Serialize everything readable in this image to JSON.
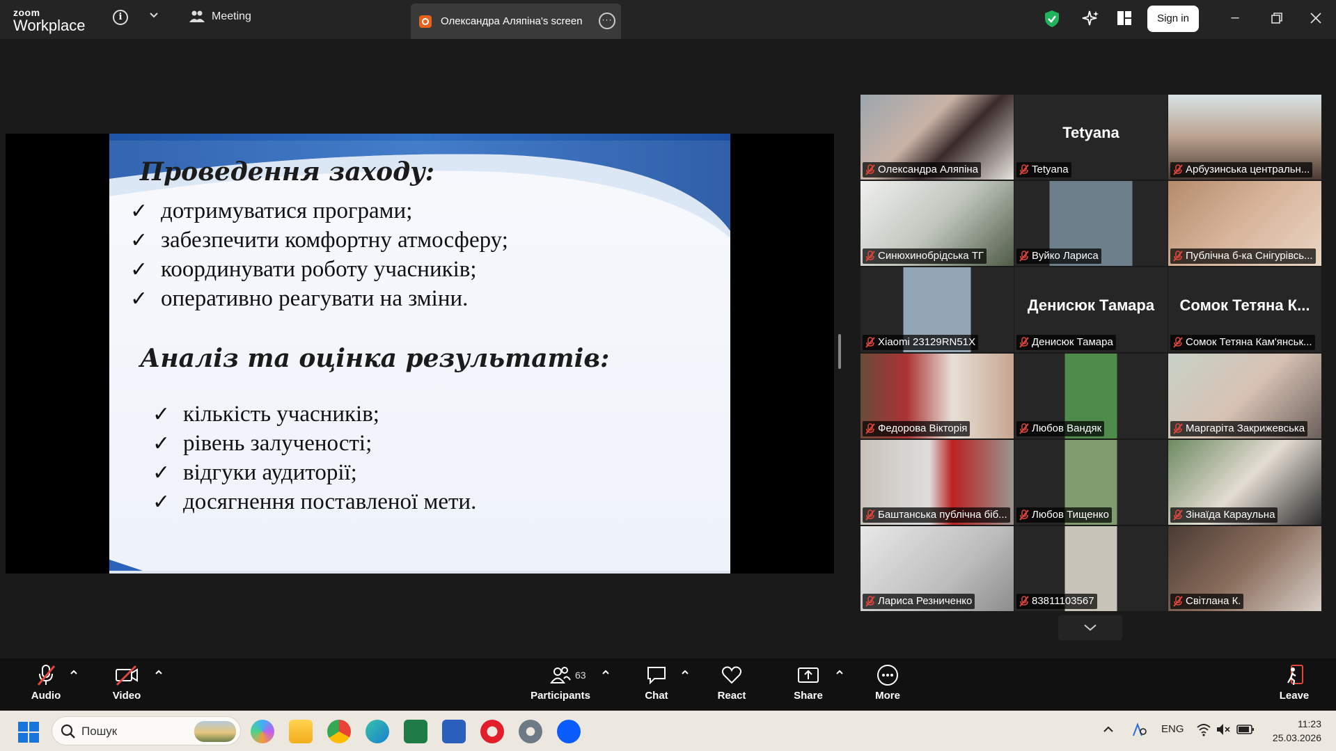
{
  "app": {
    "brand_top": "zoom",
    "brand_bottom": "Workplace",
    "meeting_tab": "Meeting",
    "screen_tab": "Олександра Аляпіна's screen",
    "sign_in": "Sign in",
    "colors": {
      "titlebar": "#242424",
      "accent_green": "#33d36b",
      "share_icon": "#e8611a",
      "muted_red": "#e0463c"
    }
  },
  "slide": {
    "heading1": "Проведення заходу:",
    "list1": [
      "дотримуватися програми;",
      "забезпечити комфортну атмосферу;",
      "координувати роботу учасників;",
      "оперативно реагувати на зміни."
    ],
    "heading2": "Аналіз та оцінка результатів:",
    "list2": [
      "кількість учасників;",
      "рівень залученості;",
      "відгуки аудиторії;",
      "досягнення поставленої мети."
    ],
    "check": "✓"
  },
  "gallery": {
    "tiles": [
      {
        "name": "Олександра Аляпіна",
        "big": "",
        "active": true
      },
      {
        "name": "Tetyana",
        "big": "Tetyana",
        "active": false
      },
      {
        "name": "Арбузинська центральн...",
        "big": "",
        "active": false
      },
      {
        "name": "Синюхинобрідська ТГ",
        "big": "",
        "active": false
      },
      {
        "name": "Вуйко Лариса",
        "big": "",
        "active": false
      },
      {
        "name": "Публічна б-ка Снігурівсь...",
        "big": "",
        "active": false
      },
      {
        "name": "Xiaomi 23129RN51X",
        "big": "",
        "active": false
      },
      {
        "name": "Денисюк Тамара",
        "big": "Денисюк Тамара",
        "active": false
      },
      {
        "name": "Сомок Тетяна Кам'янськ...",
        "big": "Сомок Тетяна К...",
        "active": false
      },
      {
        "name": "Федорова Вікторія",
        "big": "",
        "active": false
      },
      {
        "name": "Любов Вандяк",
        "big": "",
        "active": false
      },
      {
        "name": "Маргаріта Закрижевська",
        "big": "",
        "active": false
      },
      {
        "name": "Баштанська публічна біб...",
        "big": "",
        "active": false
      },
      {
        "name": "Любов Тищенко",
        "big": "",
        "active": false
      },
      {
        "name": "Зінаїда Караульна",
        "big": "",
        "active": false
      },
      {
        "name": "Лариса Резниченко",
        "big": "",
        "active": false
      },
      {
        "name": "83811103567",
        "big": "",
        "active": false
      },
      {
        "name": "Світлана К.",
        "big": "",
        "active": false
      }
    ]
  },
  "toolbar": {
    "audio": "Audio",
    "video": "Video",
    "participants": "Participants",
    "participants_count": "63",
    "chat": "Chat",
    "react": "React",
    "share": "Share",
    "more": "More",
    "leave": "Leave"
  },
  "taskbar": {
    "search_placeholder": "Пошук",
    "lang": "ENG",
    "time": "11:23",
    "date": "25.03.2026"
  }
}
